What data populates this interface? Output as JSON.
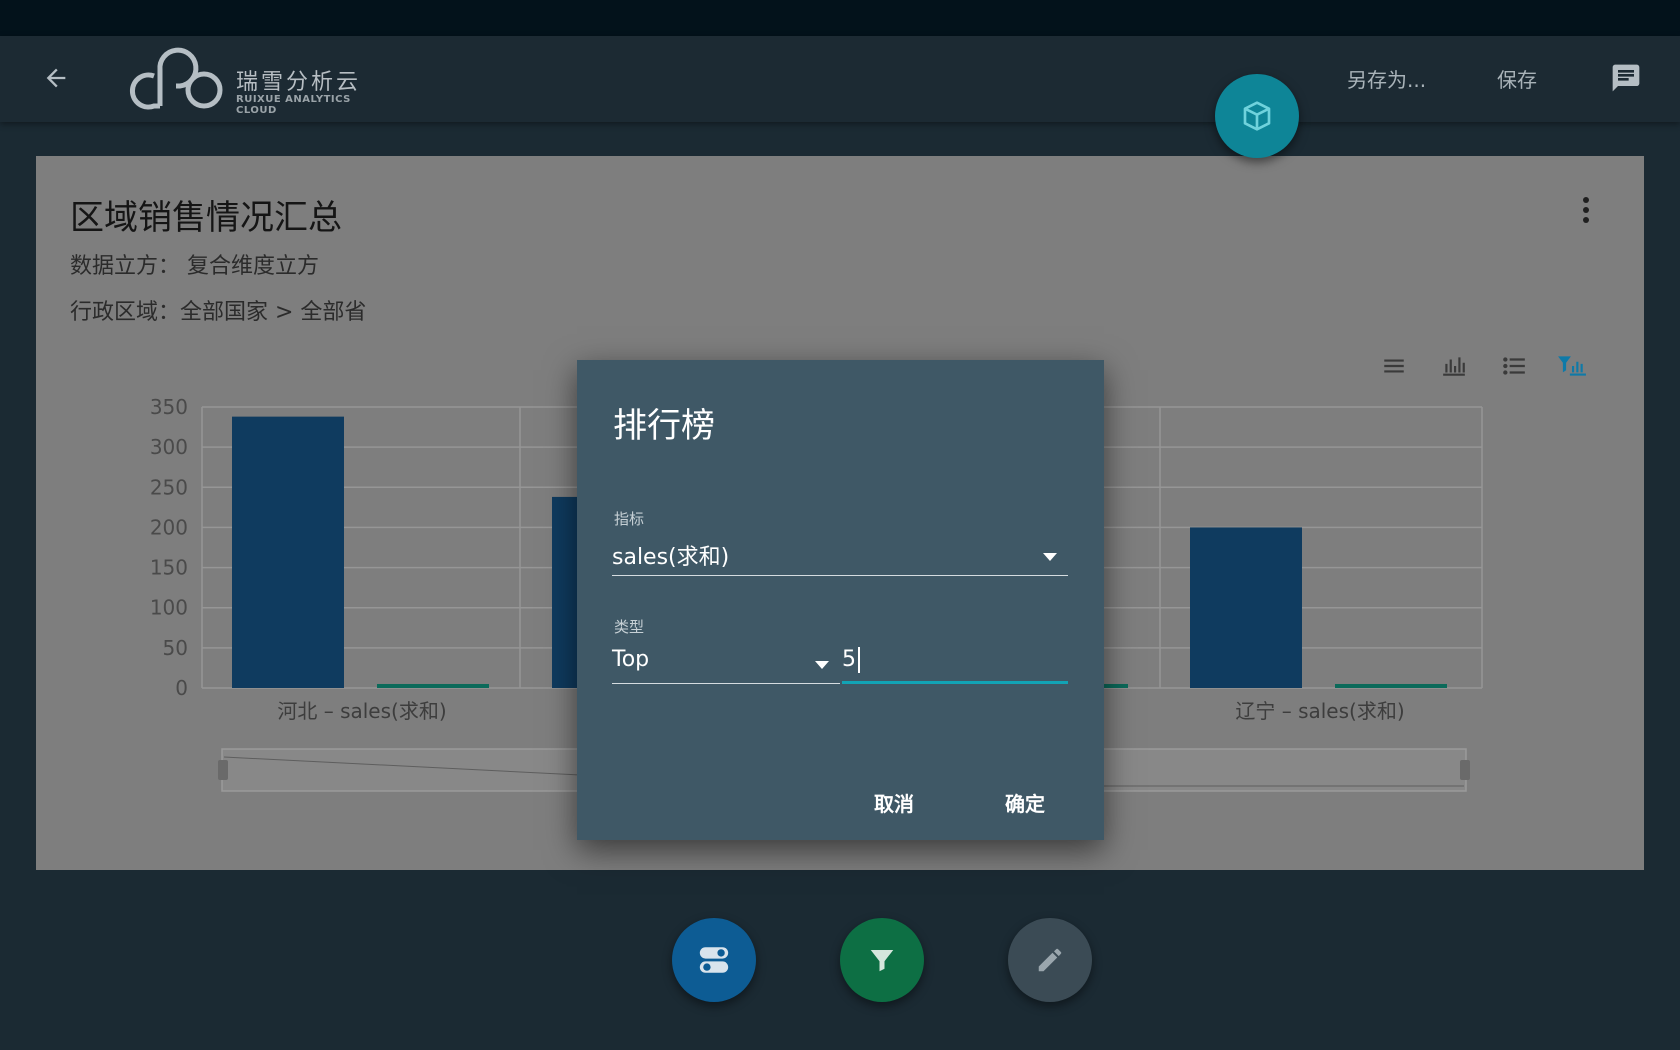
{
  "appbar": {
    "logo_text": "瑞雪分析云",
    "logo_sub": "RUIXUE ANALYTICS CLOUD",
    "save_as_label": "另存为...",
    "save_label": "保存",
    "icons": [
      "arrow-back-icon",
      "chat-icon",
      "cube-icon"
    ]
  },
  "card": {
    "title": "区域销售情况汇总",
    "cube_line": "数据立方：  复合维度立方",
    "region_line": "行政区域：全部国家 > 全部省",
    "toolbar_icons": [
      "list-icon",
      "bar-chart-icon",
      "bullet-list-icon",
      "filter-chart-icon"
    ]
  },
  "chart_data": {
    "type": "bar",
    "ylim": [
      0,
      350
    ],
    "yticks": [
      0,
      50,
      100,
      150,
      200,
      250,
      300,
      350
    ],
    "categories": [
      "河北 – sales(求和)",
      "辽宁 – sales(求和)"
    ],
    "series": [
      {
        "values": [
          338,
          200
        ],
        "color": "#0f3b5f"
      },
      {
        "values": [
          5,
          5
        ],
        "color": "#0b6a5a"
      }
    ],
    "partially_hidden_bar": {
      "value": 238,
      "color": "#0f3b5f"
    }
  },
  "dialog": {
    "title": "排行榜",
    "metric_label": "指标",
    "metric_value": "sales(求和)",
    "type_label": "类型",
    "type_value": "Top",
    "count_value": "5",
    "cancel_label": "取消",
    "ok_label": "确定"
  },
  "fabs": {
    "colors": {
      "toggle": "#0d5c94",
      "filter": "#0d6f44",
      "edit": "#3b4b55"
    },
    "icons": [
      "toggle-icon",
      "filter-icon",
      "pencil-icon"
    ]
  }
}
